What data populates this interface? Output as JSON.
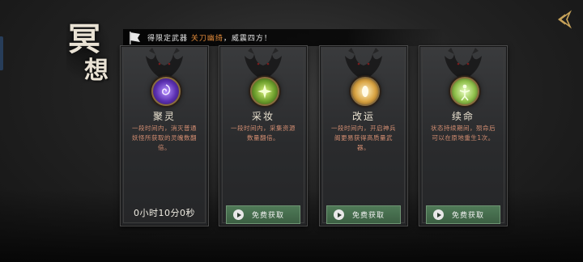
{
  "title": {
    "char1": "冥",
    "char2": "想"
  },
  "banner": {
    "prefix": "得限定武器 ",
    "highlight": "关刀幽绮",
    "suffix": "，威震四方！"
  },
  "cards": [
    {
      "name": "聚灵",
      "desc": "一段时间内，消灭普通妖怪所获取的灵魄数翻倍。",
      "timer": "0小时10分0秒",
      "button_label": "",
      "orb_color": "#7b4fd6",
      "icon": "spirit-gather-icon"
    },
    {
      "name": "采妆",
      "desc": "一段时间内，采集资源数量翻倍。",
      "timer": "",
      "button_label": "免费获取",
      "orb_color": "#7fbf3a",
      "icon": "gather-icon"
    },
    {
      "name": "改运",
      "desc": "一段时间内，开启神兵阁更易获得高质量武器。",
      "timer": "",
      "button_label": "免费获取",
      "orb_color": "#e0c070",
      "icon": "fortune-icon"
    },
    {
      "name": "续命",
      "desc": "状态持续期间，殒命后可以在原地重生1次。",
      "timer": "",
      "button_label": "免费获取",
      "orb_color": "#b6e07a",
      "icon": "revive-icon"
    }
  ]
}
